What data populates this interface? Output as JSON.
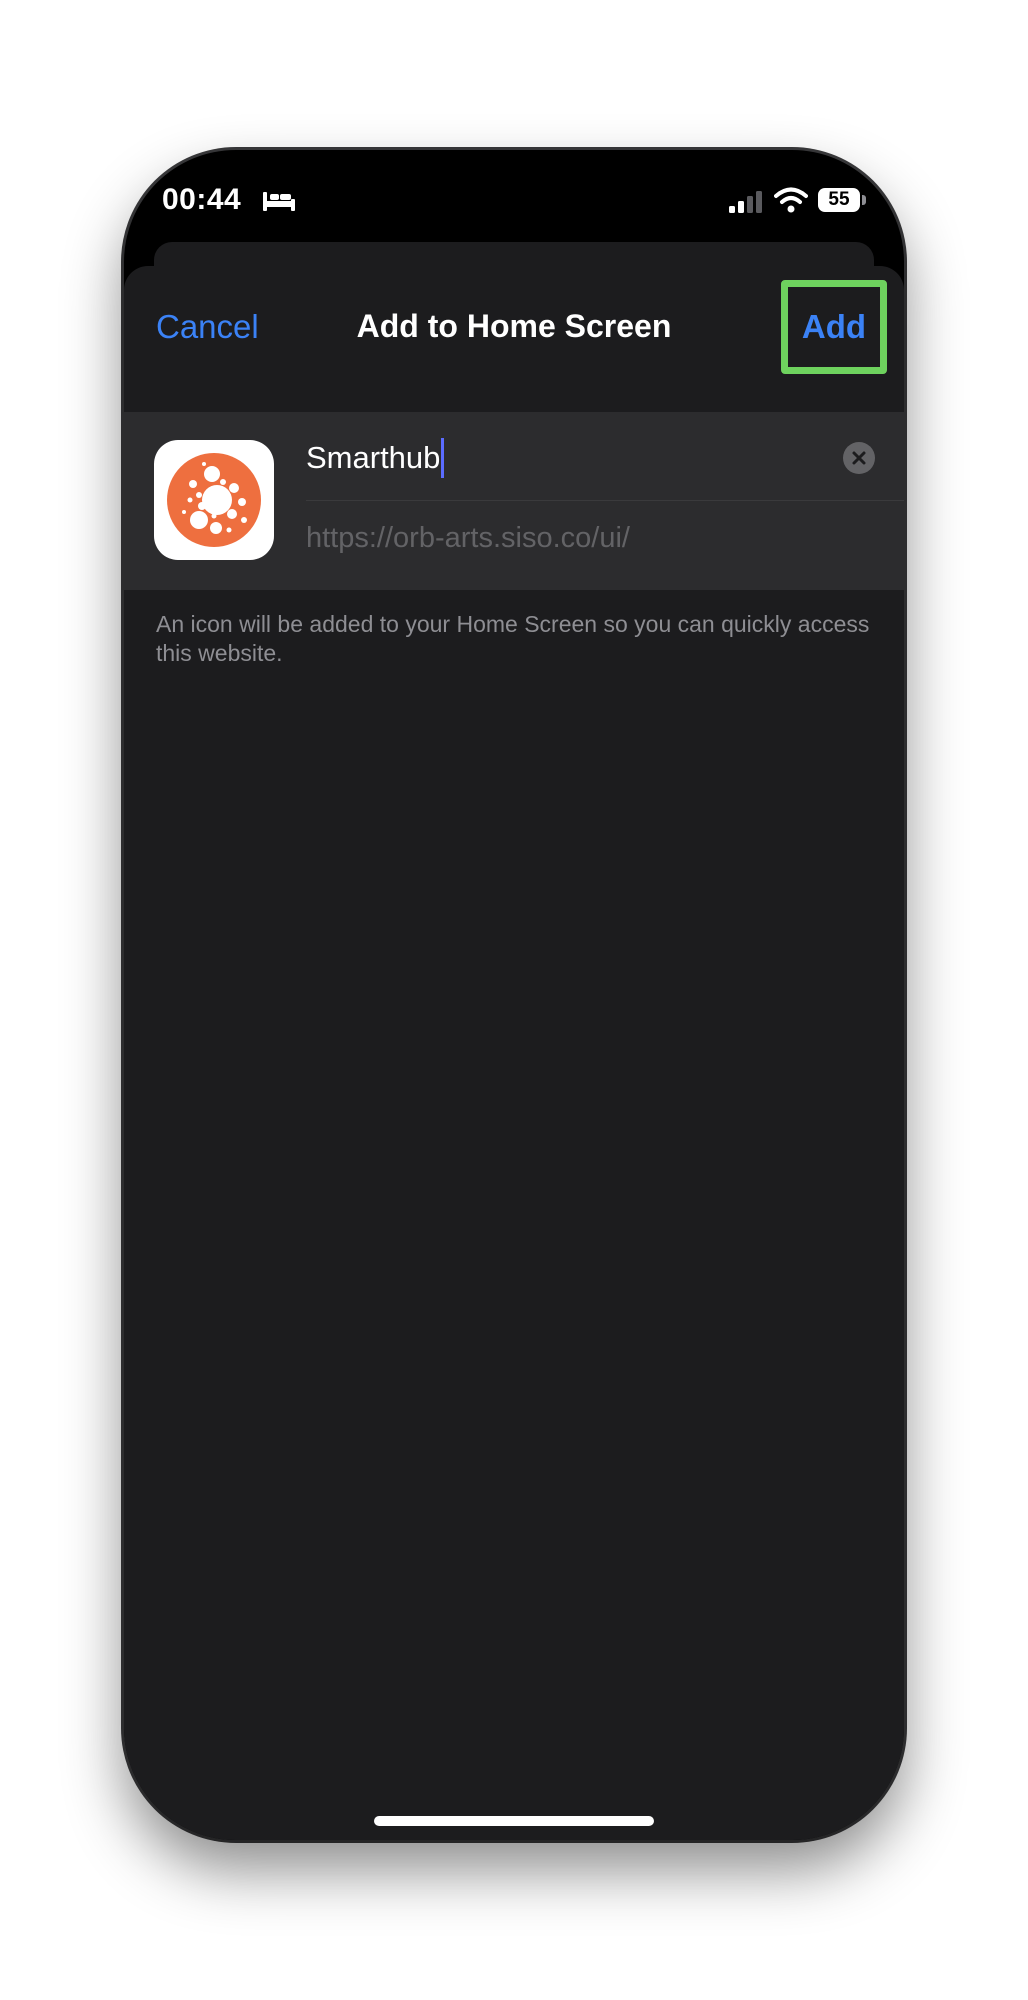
{
  "status_bar": {
    "time": "00:44",
    "battery_level": "55",
    "icons": [
      "bed-icon",
      "signal-icon",
      "wifi-icon",
      "battery-icon"
    ]
  },
  "nav": {
    "cancel_label": "Cancel",
    "title": "Add to Home Screen",
    "add_label": "Add",
    "highlight_color": "#6ed25e",
    "accent_color": "#3b82f6"
  },
  "form": {
    "name_value": "Smarthub",
    "url": "https://orb-arts.siso.co/ui/",
    "app_icon": "smarthub-orb-icon",
    "app_icon_color": "#ee6f3f"
  },
  "footnote": "An icon will be added to your Home Screen so you can quickly access this website."
}
